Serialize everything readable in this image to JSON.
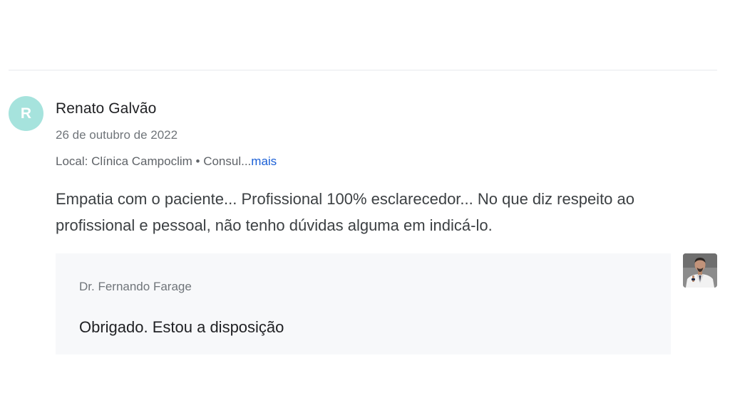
{
  "review": {
    "avatar_initial": "R",
    "author_name": "Renato Galvão",
    "date": "26 de outubro de 2022",
    "location_text": "Local: Clínica Campoclim • Consul...",
    "more_link": "mais",
    "text": "Empatia com o paciente... Profissional 100% esclarecedor... No que diz respeito ao profissional e pessoal, não tenho dúvidas alguma em indicá-lo."
  },
  "reply": {
    "author": "Dr. Fernando Farage",
    "text": "Obrigado. Estou a disposição"
  },
  "colors": {
    "avatar_bg": "#a6e3dd",
    "link": "#1a5fd6",
    "reply_bg": "#f7f8fa"
  }
}
